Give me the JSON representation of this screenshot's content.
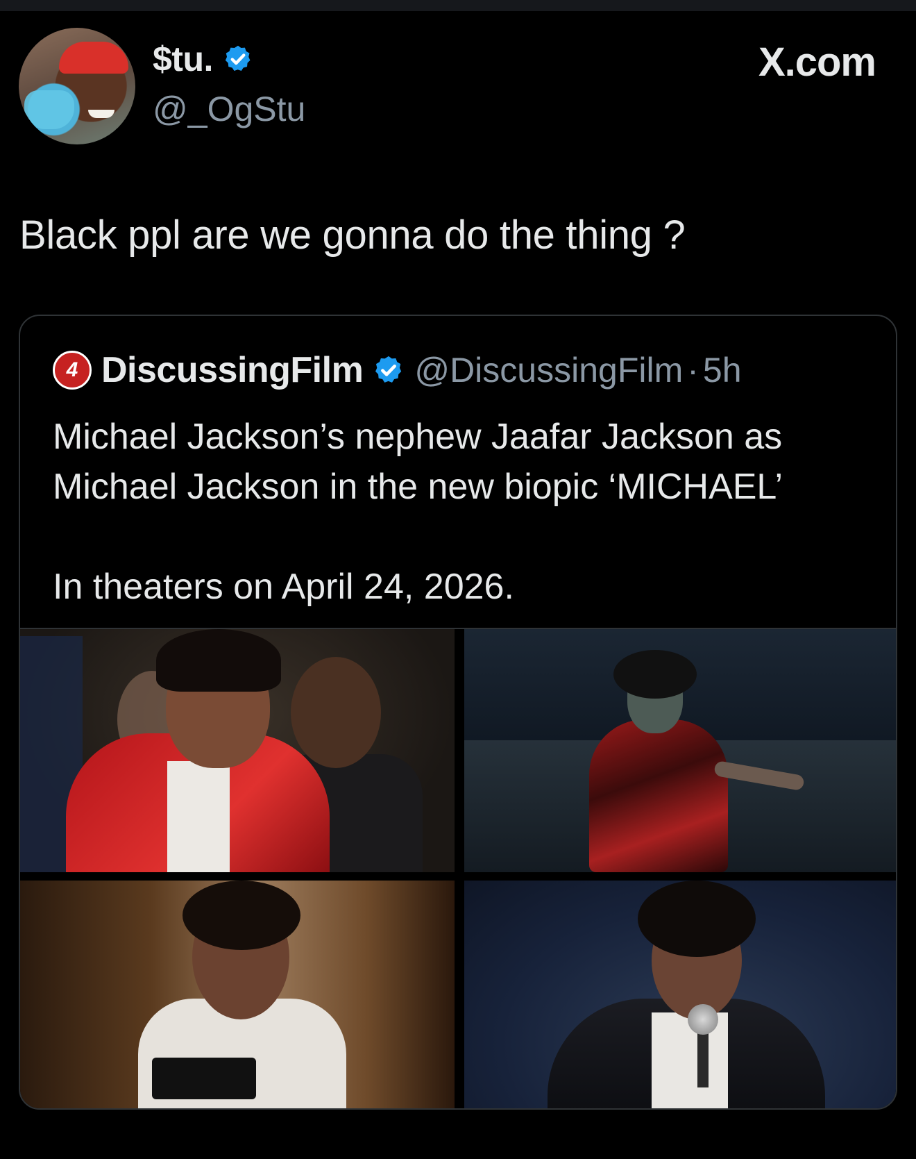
{
  "header": {
    "display_name": "$tu.",
    "handle": "@_OgStu",
    "site": "X.com",
    "verified_color": "#1d9bf0"
  },
  "tweet": {
    "text": "Black ppl are we gonna do the thing ?"
  },
  "quote": {
    "logo_text": "4",
    "name": "DiscussingFilm",
    "handle": "@DiscussingFilm",
    "separator": "·",
    "time": "5h",
    "body_line1": "Michael Jackson’s nephew Jaafar Jackson as",
    "body_line2": "Michael Jackson in the new biopic ‘MICHAEL’",
    "body_line3": "In theaters on April 24, 2026.",
    "brand_color": "#c62221"
  }
}
